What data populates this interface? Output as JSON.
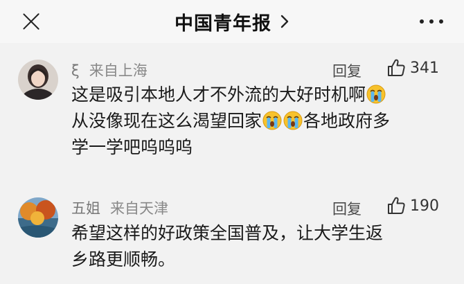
{
  "header": {
    "title": "中国青年报"
  },
  "comments": [
    {
      "name": "ξ",
      "location": "来自上海",
      "reply_label": "回复",
      "likes": "341",
      "lines": [
        "这是吸引本地人才不外流的大好时机啊",
        "从没像现在这么渴望回家",
        "各地政府多",
        "学一学吧呜呜呜"
      ],
      "emoji": "crying-face-emoji"
    },
    {
      "name": "五姐",
      "location": "来自天津",
      "reply_label": "回复",
      "likes": "190",
      "lines": [
        "希望这样的好政策全国普及，让大学生返",
        "乡路更顺畅。"
      ]
    }
  ]
}
